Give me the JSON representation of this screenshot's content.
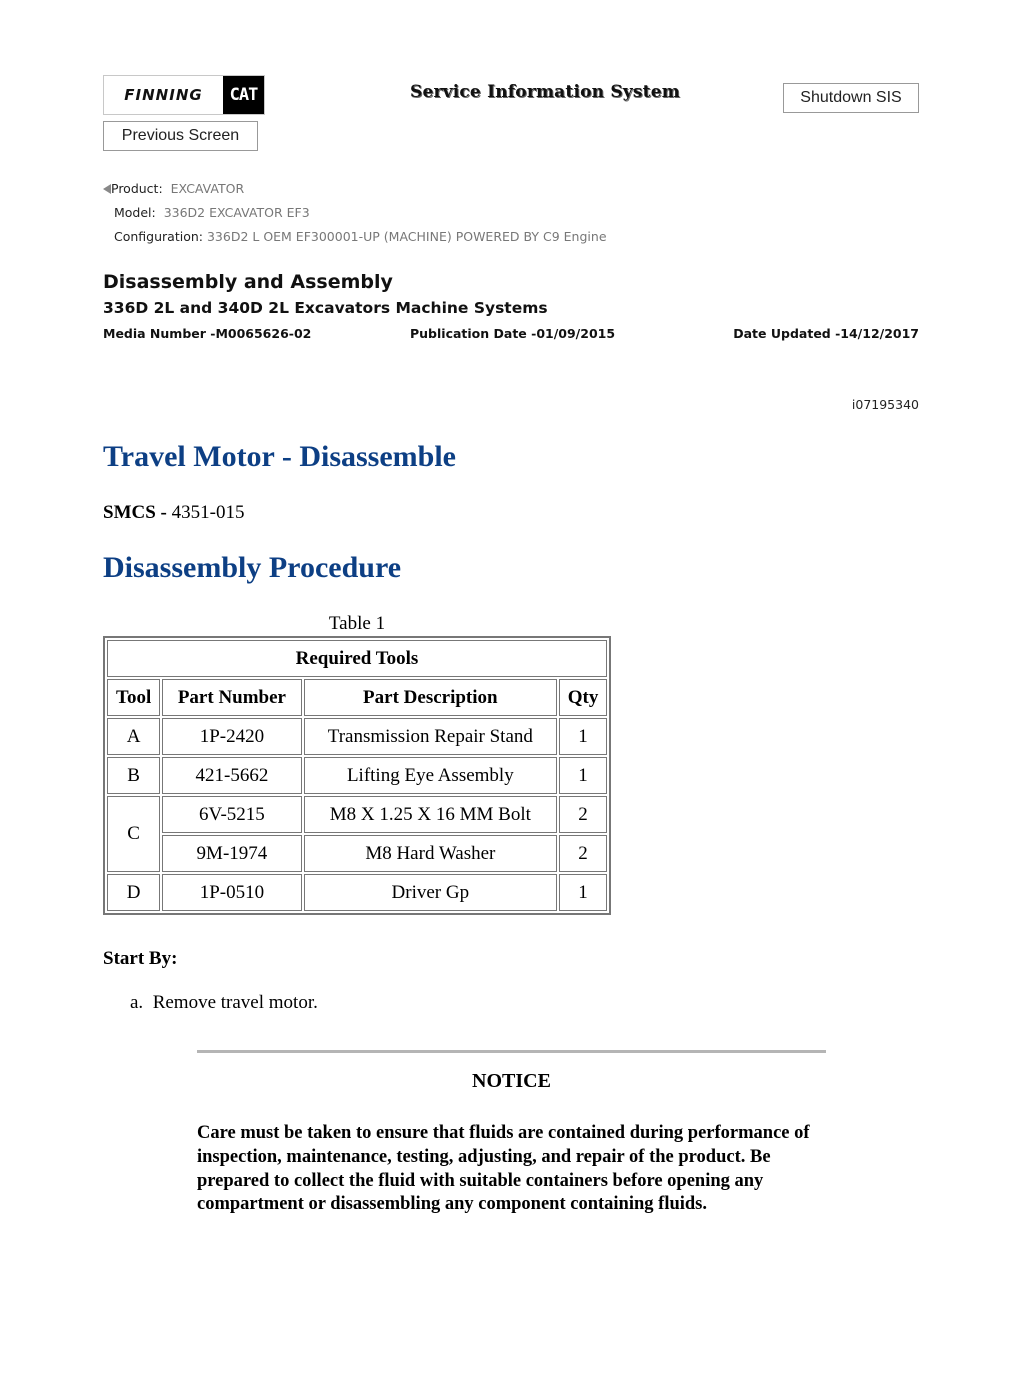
{
  "header": {
    "logo_finning": "FINNING",
    "logo_cat": "CAT",
    "system_title": "Service Information System",
    "shutdown_label": "Shutdown SIS",
    "previous_label": "Previous Screen"
  },
  "meta": {
    "product_label": "Product:",
    "product_value": "EXCAVATOR",
    "model_label": "Model:",
    "model_value": "336D2 EXCAVATOR EF3",
    "config_label": "Configuration:",
    "config_value": "336D2 L OEM EF300001-UP (MACHINE) POWERED BY C9 Engine"
  },
  "document": {
    "type": "Disassembly and Assembly",
    "subtitle": "336D 2L and 340D 2L Excavators Machine Systems",
    "media_number": "Media Number -M0065626-02",
    "publication_date": "Publication Date -01/09/2015",
    "date_updated": "Date Updated -14/12/2017",
    "doc_id": "i07195340",
    "title": "Travel Motor - Disassemble",
    "smcs_label": "SMCS -",
    "smcs_value": "4351-015",
    "section_title": "Disassembly Procedure"
  },
  "table": {
    "caption": "Table 1",
    "title": "Required Tools",
    "headers": [
      "Tool",
      "Part Number",
      "Part Description",
      "Qty"
    ],
    "rows": [
      {
        "tool": "A",
        "part": "1P-2420",
        "desc": "Transmission Repair Stand",
        "qty": "1"
      },
      {
        "tool": "B",
        "part": "421-5662",
        "desc": "Lifting Eye Assembly",
        "qty": "1"
      },
      {
        "tool": "C",
        "part": "6V-5215",
        "desc": "M8 X 1.25 X 16 MM Bolt",
        "qty": "2"
      },
      {
        "tool": "",
        "part": "9M-1974",
        "desc": "M8 Hard Washer",
        "qty": "2"
      },
      {
        "tool": "D",
        "part": "1P-0510",
        "desc": "Driver Gp",
        "qty": "1"
      }
    ]
  },
  "start_by": {
    "label": "Start By:",
    "steps": [
      {
        "marker": "a.",
        "text": "Remove travel motor."
      }
    ]
  },
  "notice": {
    "title": "NOTICE",
    "body": "Care must be taken to ensure that fluids are contained during performance of inspection, maintenance, testing, adjusting, and repair of the product. Be prepared to collect the fluid with suitable containers before opening any compartment or disassembling any component containing fluids."
  }
}
